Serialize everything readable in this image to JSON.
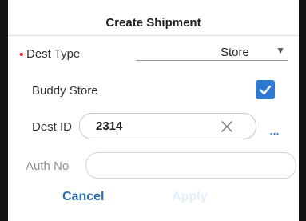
{
  "dialog": {
    "title": "Create Shipment",
    "dest_type": {
      "required_mark": "•",
      "label": "Dest Type",
      "value": "Store",
      "arrow_glyph": "▼"
    },
    "buddy_store": {
      "label": "Buddy Store",
      "checked": true
    },
    "dest_id": {
      "label": "Dest ID",
      "value": "2314",
      "more_glyph": "..."
    },
    "auth_no": {
      "label": "Auth No",
      "value": ""
    },
    "buttons": {
      "cancel": "Cancel",
      "apply": "Apply"
    }
  },
  "colors": {
    "accent": "#2f7ad0",
    "required": "#e02020",
    "disabled_text": "#e3eef9"
  }
}
